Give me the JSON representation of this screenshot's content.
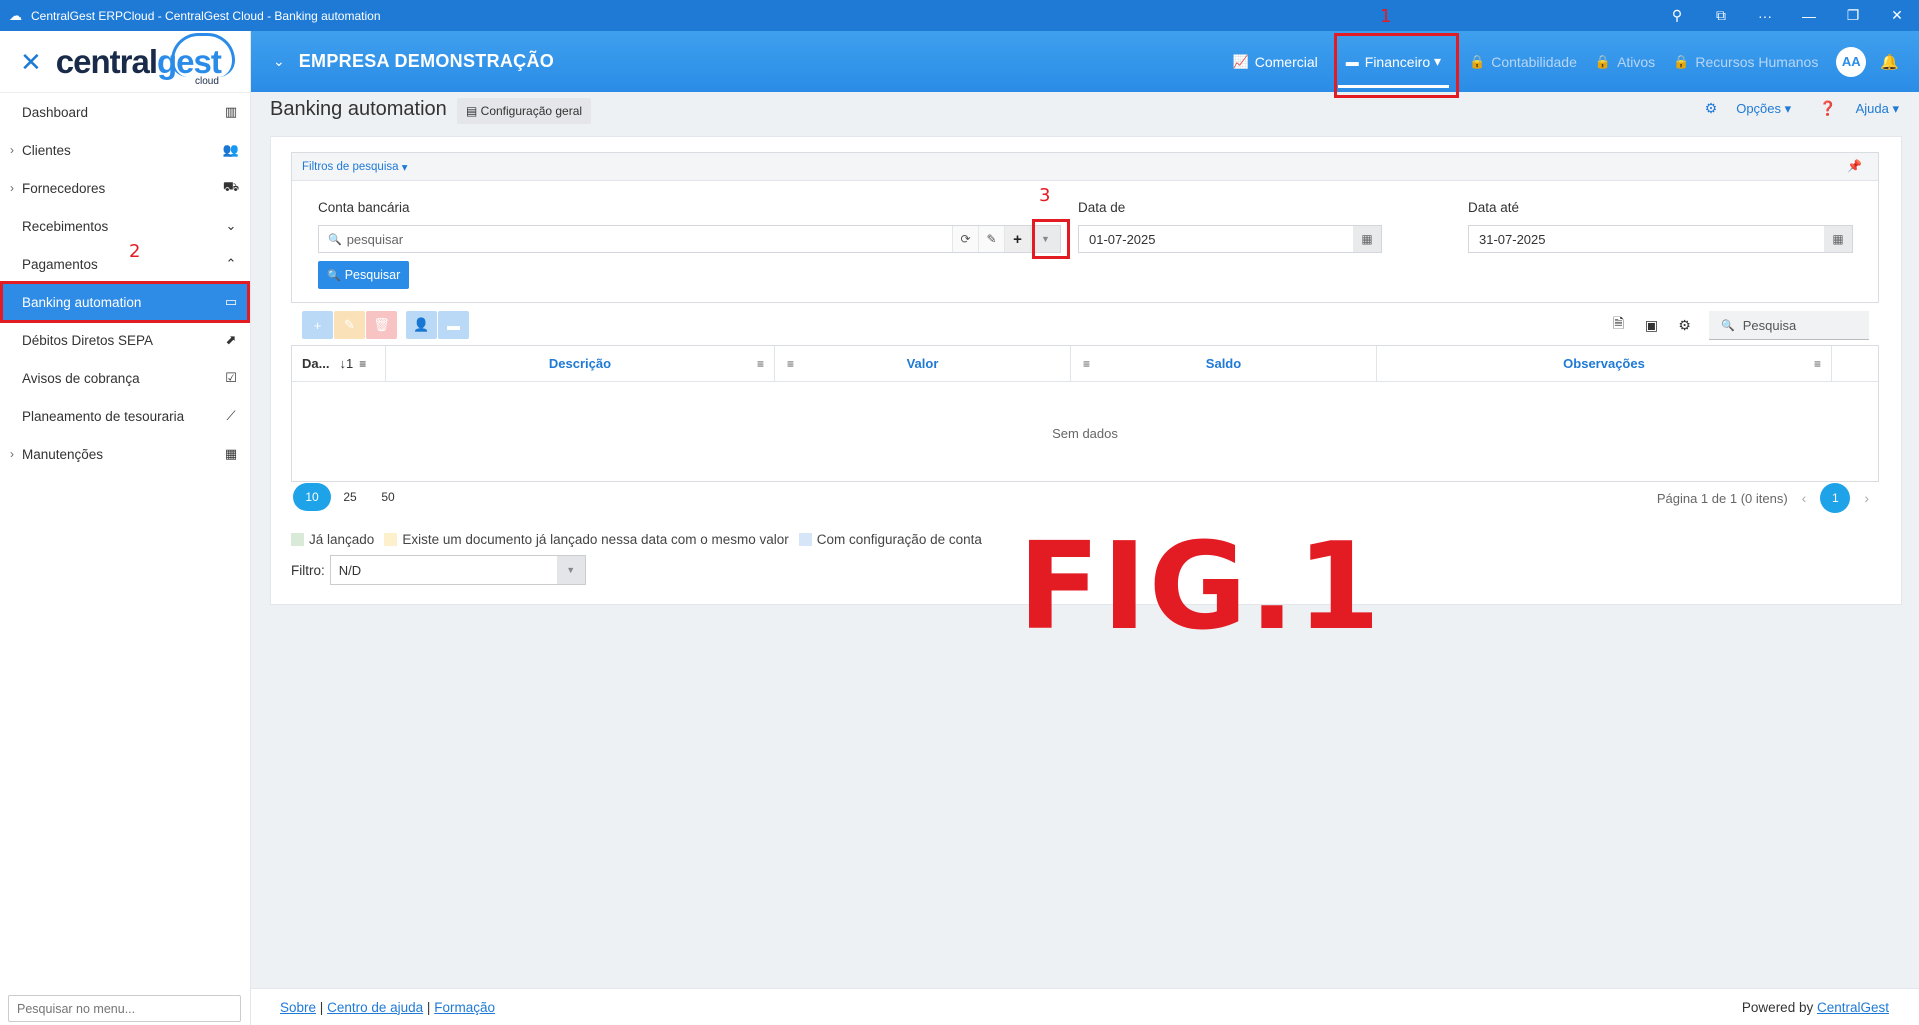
{
  "window": {
    "title": "CentralGest ERPCloud - CentralGest Cloud - Banking automation",
    "controls": [
      "⚲",
      "⧉",
      "···",
      "—",
      "❐",
      "✕"
    ]
  },
  "brand": {
    "part1": "central",
    "part2": "gest",
    "sub": "cloud"
  },
  "company": "EMPRESA DEMONSTRAÇÃO",
  "modules": [
    {
      "label": "Comercial",
      "icon": "chart-line-icon",
      "state": "enabled"
    },
    {
      "label": "Financeiro",
      "icon": "credit-card-icon",
      "state": "selected"
    },
    {
      "label": "Contabilidade",
      "icon": "lock-icon",
      "state": "disabled"
    },
    {
      "label": "Ativos",
      "icon": "lock-icon",
      "state": "disabled"
    },
    {
      "label": "Recursos Humanos",
      "icon": "lock-icon",
      "state": "disabled"
    }
  ],
  "user_initials": "AA",
  "sidebar": {
    "items": [
      {
        "label": "Dashboard",
        "expandable": false,
        "icon": "bar-chart-icon"
      },
      {
        "label": "Clientes",
        "expandable": true,
        "icon": "users-icon"
      },
      {
        "label": "Fornecedores",
        "expandable": true,
        "icon": "truck-icon"
      },
      {
        "label": "Recebimentos",
        "expandable": false,
        "icon": "circle-down-icon"
      },
      {
        "label": "Pagamentos",
        "expandable": false,
        "icon": "circle-up-icon"
      },
      {
        "label": "Banking automation",
        "expandable": false,
        "icon": "credit-card-icon",
        "active": true
      },
      {
        "label": "Débitos Diretos SEPA",
        "expandable": false,
        "icon": "external-square-icon"
      },
      {
        "label": "Avisos de cobrança",
        "expandable": false,
        "icon": "calendar-check-icon"
      },
      {
        "label": "Planeamento de tesouraria",
        "expandable": false,
        "icon": "line-chart-icon"
      },
      {
        "label": "Manutenções",
        "expandable": true,
        "icon": "table-icon"
      }
    ],
    "search_placeholder": "Pesquisar no menu..."
  },
  "page": {
    "title": "Banking automation",
    "config_button": "Configuração geral",
    "options": "Opções",
    "help": "Ajuda"
  },
  "filters": {
    "header": "Filtros de pesquisa",
    "conta_label": "Conta bancária",
    "conta_placeholder": "pesquisar",
    "data_de_label": "Data de",
    "data_de_value": "01-07-2025",
    "data_ate_label": "Data até",
    "data_ate_value": "31-07-2025",
    "search_button": "Pesquisar"
  },
  "grid": {
    "search_placeholder": "Pesquisa",
    "columns": [
      "Da...",
      "Descrição",
      "Valor",
      "Saldo",
      "Observações"
    ],
    "sort_indicator": "↓1",
    "empty_text": "Sem dados",
    "page_sizes": [
      "10",
      "25",
      "50"
    ],
    "page_info": "Página 1 de 1 (0 itens)",
    "current_page": "1"
  },
  "legend": [
    {
      "label": "Já lançado",
      "color": "#d9ead9"
    },
    {
      "label": "Existe um documento já lançado nessa data com o mesmo valor",
      "color": "#fdf0cc"
    },
    {
      "label": "Com configuração de conta",
      "color": "#d6e6f8"
    }
  ],
  "filtro": {
    "label": "Filtro:",
    "value": "N/D"
  },
  "annotations": {
    "fig": "FIG.1",
    "n1": "1",
    "n2": "2",
    "n3": "3"
  },
  "footer": {
    "sobre": "Sobre",
    "sep": "|",
    "centro": "Centro de ajuda",
    "formacao": "Formação",
    "powered_prefix": "Powered by ",
    "powered_link": "CentralGest"
  },
  "colors": {
    "primary": "#2a8ce6",
    "annotation": "#e31b23"
  }
}
